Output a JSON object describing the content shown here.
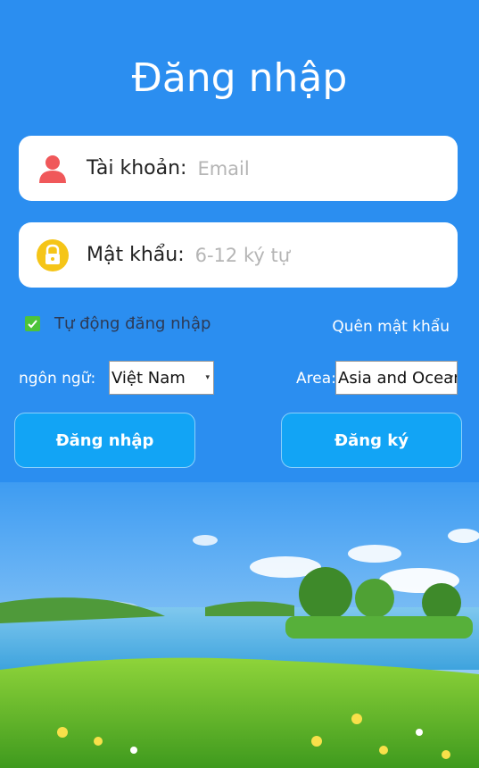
{
  "header": {
    "title": "Đăng nhập"
  },
  "account": {
    "label": "Tài khoản:",
    "placeholder": "Email",
    "value": ""
  },
  "password": {
    "label": "Mật khẩu:",
    "placeholder": "6-12 ký tự",
    "value": ""
  },
  "auto_login": {
    "label": "Tự động đăng nhập",
    "checked": true
  },
  "forgot_password": {
    "label": "Quên mật khẩu"
  },
  "language": {
    "label": "ngôn ngữ:",
    "selected": "Việt Nam"
  },
  "area": {
    "label": "Area:",
    "selected": "Asia and Oceania"
  },
  "buttons": {
    "login": "Đăng nhập",
    "register": "Đăng ký"
  },
  "icons": {
    "account": "user-icon",
    "password": "lock-icon",
    "checkbox": "check-icon"
  },
  "colors": {
    "background": "#2b8ef0",
    "button": "#12a4f5",
    "checkbox": "#4dc33a",
    "user_icon": "#f0585a",
    "lock_icon": "#f5c518"
  }
}
